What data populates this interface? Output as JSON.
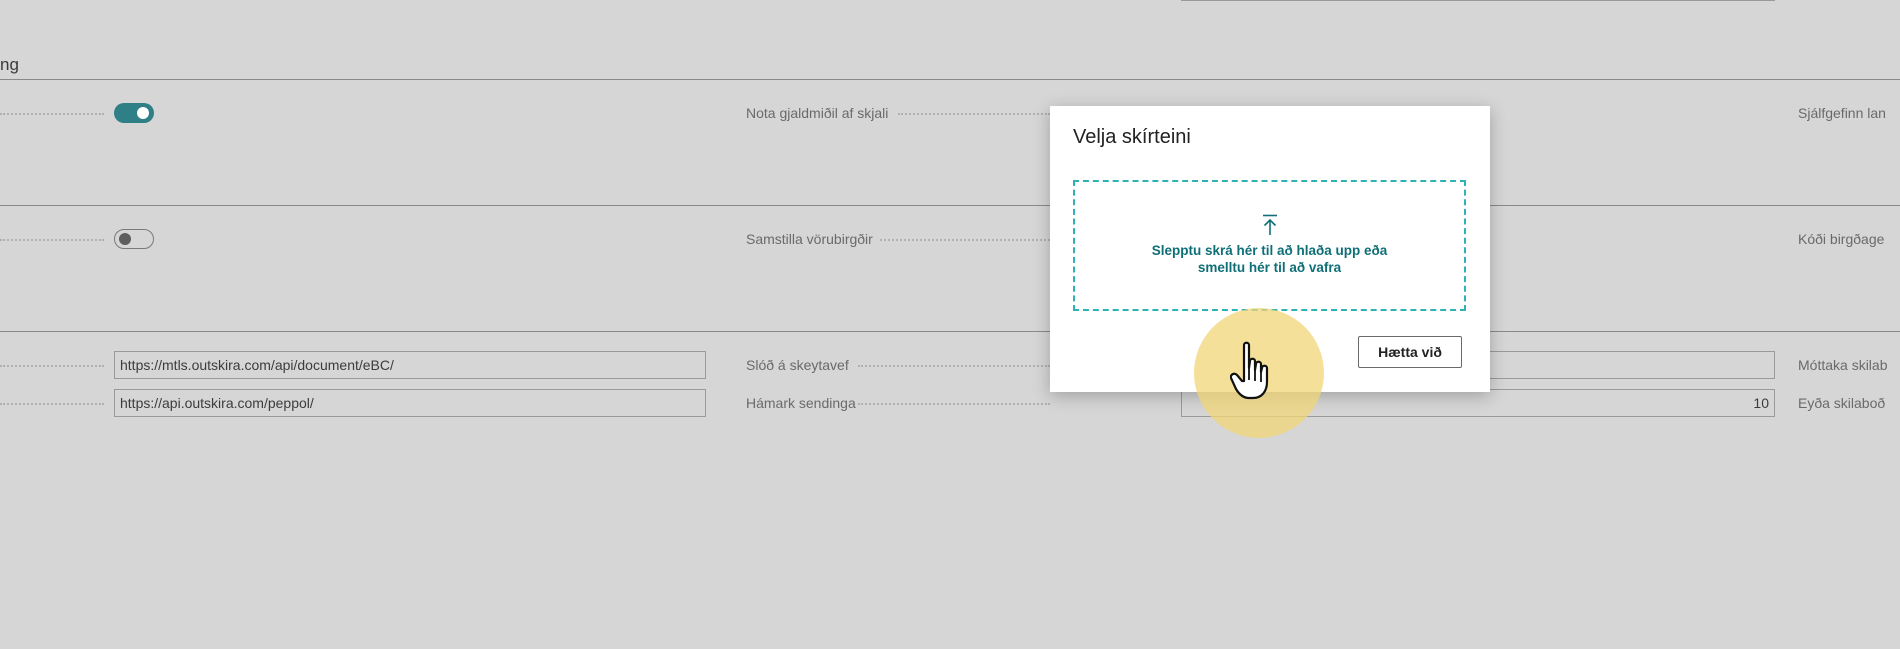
{
  "section": {
    "title_fragment": "ng"
  },
  "rows": {
    "row1": {
      "middle_label": "Nota gjaldmiðil af skjali",
      "right_label": "Sjálfgefinn lan",
      "toggle_state": "on"
    },
    "row2": {
      "middle_label": "Samstilla vörubirgðir",
      "right_label": "Kóði birgðage",
      "toggle_state": "off"
    },
    "row3": {
      "url_value": "https://mtls.outskira.com/api/document/eBC/",
      "middle_label": "Slóð á skeytavef",
      "right_label": "Móttaka skilab"
    },
    "row4": {
      "url_value": "https://api.outskira.com/peppol/",
      "middle_label": "Hámark sendinga",
      "number_value": "10",
      "right_label": "Eyða skilaboð"
    }
  },
  "dialog": {
    "title": "Velja skírteini",
    "drop_line1": "Slepptu skrá hér til að hlaða upp eða",
    "drop_line2": "smelltu hér til að vafra",
    "cancel_label": "Hætta við"
  },
  "colors": {
    "accent": "#2e7f86",
    "dropzone_border": "#2fb2b6",
    "drop_text": "#0f6f77",
    "background": "#d6d6d6",
    "cursor_highlight": "#f2d678"
  },
  "icons": [
    "upload-icon",
    "hand-cursor-icon"
  ]
}
